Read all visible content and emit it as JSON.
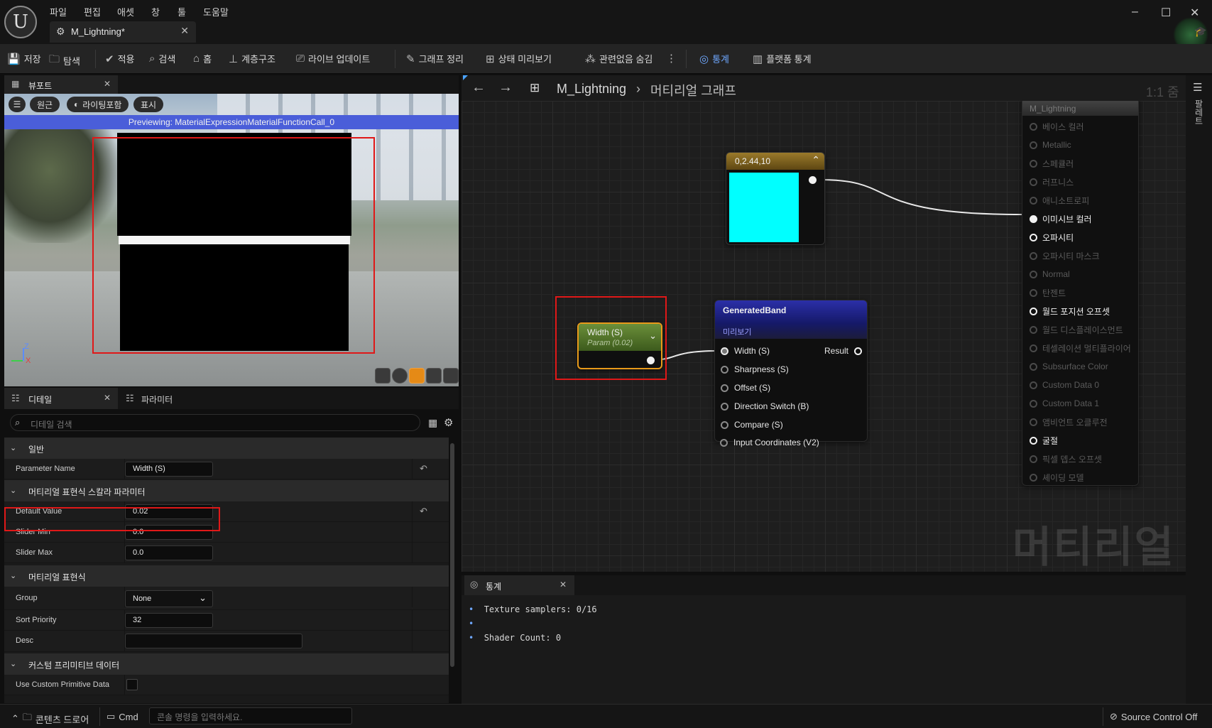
{
  "menu": [
    "파일",
    "편집",
    "애셋",
    "창",
    "툴",
    "도움말"
  ],
  "doc_tab": {
    "title": "M_Lightning*"
  },
  "window_controls": {
    "minimize": "–",
    "maximize": "☐",
    "close": "✕"
  },
  "toolbar": {
    "save": "저장",
    "browse": "탐색",
    "apply": "적용",
    "search": "검색",
    "home": "홈",
    "hierarchy": "계층구조",
    "live_update": "라이브 업데이트",
    "clean_graph": "그래프 정리",
    "preview_state": "상태 미리보기",
    "hide_unrelated": "관련없음 숨김",
    "stats": "통계",
    "platform_stats": "플랫폼 통계"
  },
  "viewport": {
    "tab_label": "뷰포트",
    "perspective": "원근",
    "lit": "라이팅포함",
    "show": "표시",
    "banner": "Previewing: MaterialExpressionMaterialFunctionCall_0",
    "axis_z": "Z",
    "axis_x": "X"
  },
  "details": {
    "tab_label": "디테일",
    "params_tab_label": "파라미터",
    "search_placeholder": "디테일 검색",
    "cat_general": "일반",
    "cat_scalar": "머티리얼 표현식 스칼라 파라미터",
    "cat_expression": "머티리얼 표현식",
    "cat_custom": "커스텀 프리미티브 데이터",
    "props": {
      "param_name": {
        "label": "Parameter Name",
        "value": "Width (S)"
      },
      "default_value": {
        "label": "Default Value",
        "value": "0.02"
      },
      "slider_min": {
        "label": "Slider Min",
        "value": "0.0"
      },
      "slider_max": {
        "label": "Slider Max",
        "value": "0.0"
      },
      "group": {
        "label": "Group",
        "value": "None"
      },
      "sort_priority": {
        "label": "Sort Priority",
        "value": "32"
      },
      "desc": {
        "label": "Desc",
        "value": ""
      },
      "use_custom": {
        "label": "Use Custom Primitive Data"
      }
    }
  },
  "graph": {
    "breadcrumb_asset": "M_Lightning",
    "breadcrumb_graph": "머티리얼 그래프",
    "zoom": "1:1 줌",
    "side_label": "팔레트",
    "watermark": "머티리얼",
    "color_node": {
      "title": "0,2.44,10",
      "swatch": "#00ffff"
    },
    "param_node": {
      "title": "Width (S)",
      "subtitle": "Param (0.02)"
    },
    "func_node": {
      "title": "GeneratedBand",
      "preview": "미리보기",
      "result": "Result",
      "inputs": [
        "Width (S)",
        "Sharpness (S)",
        "Offset (S)",
        "Direction Switch (B)",
        "Compare (S)",
        "Input Coordinates (V2)"
      ]
    },
    "material_node": {
      "title": "M_Lightning",
      "pins": [
        {
          "label": "베이스 컬러",
          "active": false
        },
        {
          "label": "Metallic",
          "active": false
        },
        {
          "label": "스페큘러",
          "active": false
        },
        {
          "label": "러프니스",
          "active": false
        },
        {
          "label": "애니소트로피",
          "active": false
        },
        {
          "label": "이미시브 컬러",
          "active": true,
          "connected": true
        },
        {
          "label": "오파시티",
          "active": true
        },
        {
          "label": "오파시티 마스크",
          "active": false
        },
        {
          "label": "Normal",
          "active": false
        },
        {
          "label": "탄젠트",
          "active": false
        },
        {
          "label": "월드 포지션 오프셋",
          "active": true
        },
        {
          "label": "월드 디스플레이스먼트",
          "active": false
        },
        {
          "label": "테셀레이션 멀티플라이어",
          "active": false
        },
        {
          "label": "Subsurface Color",
          "active": false
        },
        {
          "label": "Custom Data 0",
          "active": false
        },
        {
          "label": "Custom Data 1",
          "active": false
        },
        {
          "label": "앰비언트 오클루전",
          "active": false
        },
        {
          "label": "굴절",
          "active": true
        },
        {
          "label": "픽셀 뎁스 오프셋",
          "active": false
        },
        {
          "label": "셰이딩 모델",
          "active": false
        }
      ]
    }
  },
  "stats": {
    "tab_label": "통계",
    "lines": [
      "Texture samplers: 0/16",
      "",
      "Shader Count: 0"
    ]
  },
  "statusbar": {
    "content_drawer": "콘텐츠 드로어",
    "cmd": "Cmd",
    "cmd_placeholder": "콘솔 명령을 입력하세요.",
    "source_control": "Source Control Off"
  }
}
